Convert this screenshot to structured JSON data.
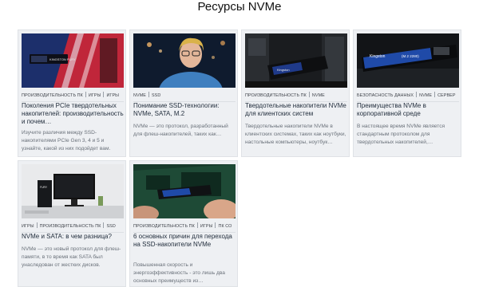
{
  "page": {
    "title": "Ресурсы NVMe"
  },
  "cards": [
    {
      "tags": [
        "ПРОИЗВОДИТЕЛЬНОСТЬ ПК",
        "ИГРЫ",
        "ИГРЫ"
      ],
      "title": "Поколения PCIe твердотельных накопителей: производительность и почем…",
      "desc": "Изучите различия между SSD-накопителями PCIe Gen 3, 4 и 5 и узнайте, какой из них подойдет вам."
    },
    {
      "tags": [
        "NVME",
        "SSD"
      ],
      "title": "Понимание SSD-технологии: NVMe, SATA, M.2",
      "desc": "NVMe — это протокол, разработанный для флеш-накопителей, таких как…"
    },
    {
      "tags": [
        "ПРОИЗВОДИТЕЛЬНОСТЬ ПК",
        "NVME"
      ],
      "title": "Твердотельные накопители NVMe для клиентских систем",
      "desc": "Твердотельные накопители NVMe в клиентских системах, таких как ноутбуки, настольные компьютеры, ноутбук…"
    },
    {
      "tags": [
        "БЕЗОПАСНОСТЬ ДАННЫХ",
        "NVME",
        "СЕРВЕР"
      ],
      "title": "Преимущества NVMe в корпоративной среде",
      "desc": "В настоящее время NVMe является стандартным протоколом для твердотельных накопителей,…"
    },
    {
      "tags": [
        "ИГРЫ",
        "ПРОИЗВОДИТЕЛЬНОСТЬ ПК",
        "SSD"
      ],
      "title": "NVMe и SATA: в чем разница?",
      "desc": "NVMe — это новый протокол для флеш-памяти, в то время как SATA был унаследован от жестких дисков."
    },
    {
      "tags": [
        "ПРОИЗВОДИТЕЛЬНОСТЬ ПК",
        "ИГРЫ",
        "ПК СО"
      ],
      "title": "6 основных причин для перехода на SSD-накопители NVMe",
      "desc": "Повышенная скорость и энергоэффективность - это лишь два основных преимуществ из…"
    }
  ],
  "images": {
    "card1": {
      "brand": "KINGSTON FURY",
      "icon": "nvme-ssd-on-red-blue-image"
    },
    "card2": {
      "icon": "woman-with-glasses-photo"
    },
    "card3": {
      "brand": "Kingston",
      "icon": "ssd-in-motherboard-photo"
    },
    "card4": {
      "brand": "Kingston",
      "model": "(M.2 2280)",
      "icon": "kingston-nvme-ssd-photo"
    },
    "card5": {
      "brand": "FURY",
      "icon": "desktop-pc-monitor-photo"
    },
    "card6": {
      "icon": "laptop-ssd-install-photo"
    }
  },
  "colors": {
    "accent": "#1f2b3a",
    "card_bg": "#eef0f3",
    "muted_text": "#6a717a"
  }
}
